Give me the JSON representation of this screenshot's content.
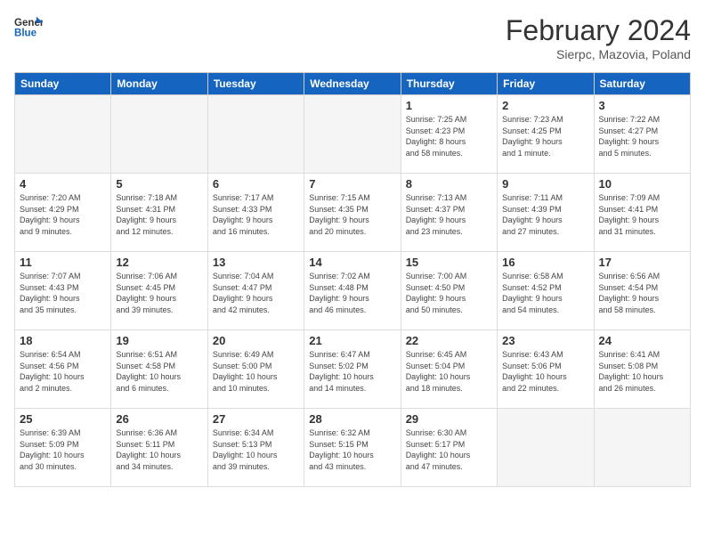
{
  "header": {
    "logo_line1": "General",
    "logo_line2": "Blue",
    "month_title": "February 2024",
    "subtitle": "Sierpc, Mazovia, Poland"
  },
  "weekdays": [
    "Sunday",
    "Monday",
    "Tuesday",
    "Wednesday",
    "Thursday",
    "Friday",
    "Saturday"
  ],
  "weeks": [
    [
      {
        "num": "",
        "info": ""
      },
      {
        "num": "",
        "info": ""
      },
      {
        "num": "",
        "info": ""
      },
      {
        "num": "",
        "info": ""
      },
      {
        "num": "1",
        "info": "Sunrise: 7:25 AM\nSunset: 4:23 PM\nDaylight: 8 hours\nand 58 minutes."
      },
      {
        "num": "2",
        "info": "Sunrise: 7:23 AM\nSunset: 4:25 PM\nDaylight: 9 hours\nand 1 minute."
      },
      {
        "num": "3",
        "info": "Sunrise: 7:22 AM\nSunset: 4:27 PM\nDaylight: 9 hours\nand 5 minutes."
      }
    ],
    [
      {
        "num": "4",
        "info": "Sunrise: 7:20 AM\nSunset: 4:29 PM\nDaylight: 9 hours\nand 9 minutes."
      },
      {
        "num": "5",
        "info": "Sunrise: 7:18 AM\nSunset: 4:31 PM\nDaylight: 9 hours\nand 12 minutes."
      },
      {
        "num": "6",
        "info": "Sunrise: 7:17 AM\nSunset: 4:33 PM\nDaylight: 9 hours\nand 16 minutes."
      },
      {
        "num": "7",
        "info": "Sunrise: 7:15 AM\nSunset: 4:35 PM\nDaylight: 9 hours\nand 20 minutes."
      },
      {
        "num": "8",
        "info": "Sunrise: 7:13 AM\nSunset: 4:37 PM\nDaylight: 9 hours\nand 23 minutes."
      },
      {
        "num": "9",
        "info": "Sunrise: 7:11 AM\nSunset: 4:39 PM\nDaylight: 9 hours\nand 27 minutes."
      },
      {
        "num": "10",
        "info": "Sunrise: 7:09 AM\nSunset: 4:41 PM\nDaylight: 9 hours\nand 31 minutes."
      }
    ],
    [
      {
        "num": "11",
        "info": "Sunrise: 7:07 AM\nSunset: 4:43 PM\nDaylight: 9 hours\nand 35 minutes."
      },
      {
        "num": "12",
        "info": "Sunrise: 7:06 AM\nSunset: 4:45 PM\nDaylight: 9 hours\nand 39 minutes."
      },
      {
        "num": "13",
        "info": "Sunrise: 7:04 AM\nSunset: 4:47 PM\nDaylight: 9 hours\nand 42 minutes."
      },
      {
        "num": "14",
        "info": "Sunrise: 7:02 AM\nSunset: 4:48 PM\nDaylight: 9 hours\nand 46 minutes."
      },
      {
        "num": "15",
        "info": "Sunrise: 7:00 AM\nSunset: 4:50 PM\nDaylight: 9 hours\nand 50 minutes."
      },
      {
        "num": "16",
        "info": "Sunrise: 6:58 AM\nSunset: 4:52 PM\nDaylight: 9 hours\nand 54 minutes."
      },
      {
        "num": "17",
        "info": "Sunrise: 6:56 AM\nSunset: 4:54 PM\nDaylight: 9 hours\nand 58 minutes."
      }
    ],
    [
      {
        "num": "18",
        "info": "Sunrise: 6:54 AM\nSunset: 4:56 PM\nDaylight: 10 hours\nand 2 minutes."
      },
      {
        "num": "19",
        "info": "Sunrise: 6:51 AM\nSunset: 4:58 PM\nDaylight: 10 hours\nand 6 minutes."
      },
      {
        "num": "20",
        "info": "Sunrise: 6:49 AM\nSunset: 5:00 PM\nDaylight: 10 hours\nand 10 minutes."
      },
      {
        "num": "21",
        "info": "Sunrise: 6:47 AM\nSunset: 5:02 PM\nDaylight: 10 hours\nand 14 minutes."
      },
      {
        "num": "22",
        "info": "Sunrise: 6:45 AM\nSunset: 5:04 PM\nDaylight: 10 hours\nand 18 minutes."
      },
      {
        "num": "23",
        "info": "Sunrise: 6:43 AM\nSunset: 5:06 PM\nDaylight: 10 hours\nand 22 minutes."
      },
      {
        "num": "24",
        "info": "Sunrise: 6:41 AM\nSunset: 5:08 PM\nDaylight: 10 hours\nand 26 minutes."
      }
    ],
    [
      {
        "num": "25",
        "info": "Sunrise: 6:39 AM\nSunset: 5:09 PM\nDaylight: 10 hours\nand 30 minutes."
      },
      {
        "num": "26",
        "info": "Sunrise: 6:36 AM\nSunset: 5:11 PM\nDaylight: 10 hours\nand 34 minutes."
      },
      {
        "num": "27",
        "info": "Sunrise: 6:34 AM\nSunset: 5:13 PM\nDaylight: 10 hours\nand 39 minutes."
      },
      {
        "num": "28",
        "info": "Sunrise: 6:32 AM\nSunset: 5:15 PM\nDaylight: 10 hours\nand 43 minutes."
      },
      {
        "num": "29",
        "info": "Sunrise: 6:30 AM\nSunset: 5:17 PM\nDaylight: 10 hours\nand 47 minutes."
      },
      {
        "num": "",
        "info": ""
      },
      {
        "num": "",
        "info": ""
      }
    ]
  ]
}
